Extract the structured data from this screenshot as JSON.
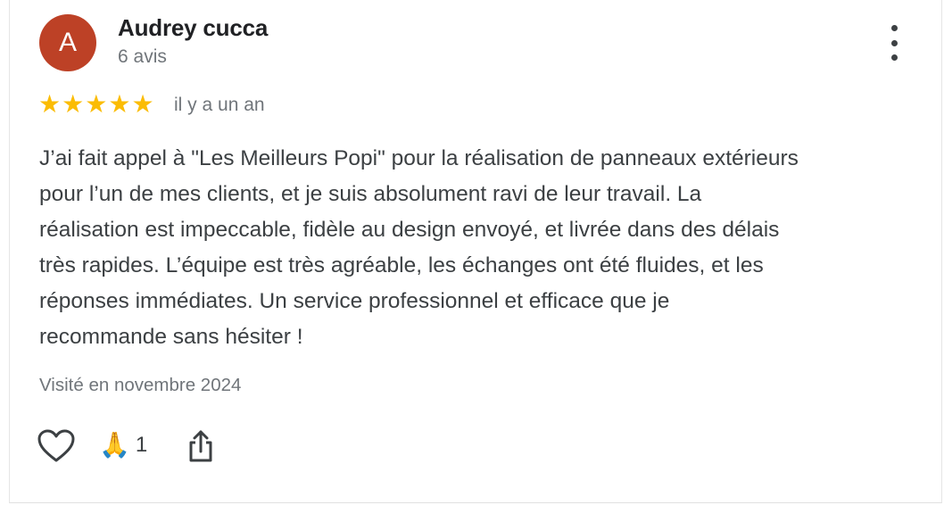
{
  "review": {
    "author_name": "Audrey cucca",
    "avatar_letter": "A",
    "avatar_color": "#bd4126",
    "review_count": "6 avis",
    "rating": 5,
    "rating_max": 5,
    "star_color": "#fbbc04",
    "stars": [
      "★",
      "★",
      "★",
      "★",
      "★"
    ],
    "date": "il y a un an",
    "text": "J’ai fait appel à \"Les Meilleurs Popi\" pour la réalisation de panneaux extérieurs\npour l’un de mes clients, et je suis absolument ravi de leur travail. La\nréalisation est impeccable, fidèle au design envoyé, et livrée dans des délais\ntrès rapides. L’équipe est très agréable, les échanges ont été fluides, et les\nréponses immédiates. Un service professionnel et efficace que je\nrecommande sans hésiter !",
    "visited": "Visité en novembre 2024"
  },
  "actions": {
    "like_icon": "heart-outline-icon",
    "reaction_icon": "🙏",
    "reaction_count": "1",
    "share_icon": "share-icon",
    "more_icon": "more-vert-icon"
  }
}
